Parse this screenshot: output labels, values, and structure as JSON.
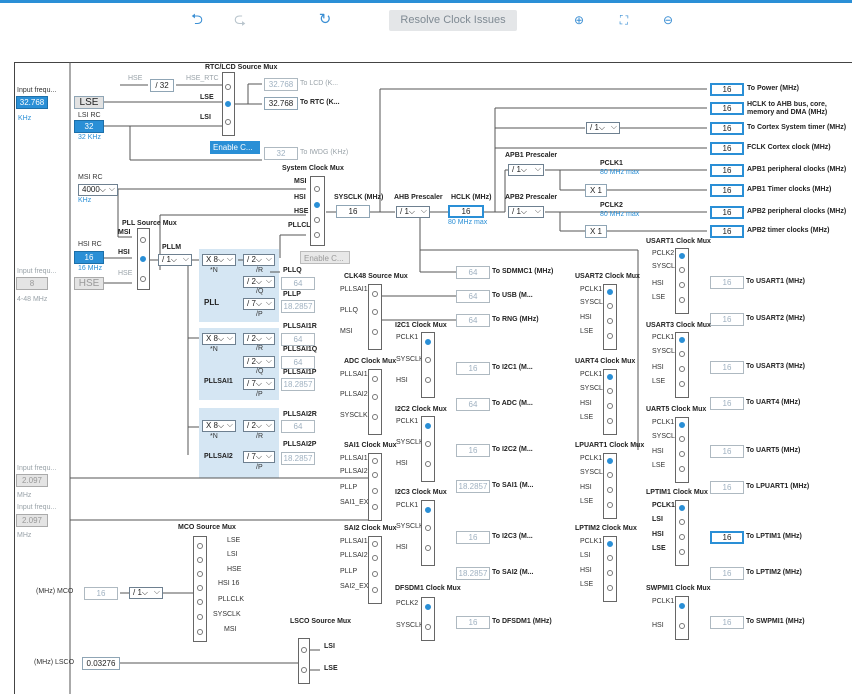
{
  "toolbar": {
    "undo_icon": "undo-icon",
    "redo_icon": "redo-icon",
    "refresh_icon": "refresh-icon",
    "resolve": "Resolve Clock Issues",
    "zoom_in_icon": "zoom-in-icon",
    "fit_icon": "fit-icon",
    "zoom_out_icon": "zoom-out-icon"
  },
  "inputs": {
    "lse_freq_label": "Input frequ...",
    "lse_freq": "32.768",
    "lse_unit": "KHz",
    "lse": "LSE",
    "lsi_rc": "LSI RC",
    "lsi_val": "32",
    "lsi_unit": "32 KHz",
    "msi_rc": "MSI RC",
    "msi_val": "4000",
    "msi_unit": "KHz",
    "hsi_rc": "HSI RC",
    "hsi_val": "16",
    "hsi_unit": "16 MHz",
    "hse_freq_label": "Input frequ...",
    "hse_freq": "8",
    "hse": "HSE",
    "hse_range": "4-48 MHz",
    "in1_label": "Input frequ...",
    "in1": "2.097",
    "in1_unit": "MHz",
    "in2_label": "Input frequ...",
    "in2": "2.097",
    "in2_unit": "MHz"
  },
  "rtc": {
    "title": "RTC/LCD Source Mux",
    "hse": "HSE",
    "div32": "/ 32",
    "hse_rtc": "HSE_RTC",
    "lse": "LSE",
    "lsi": "LSI",
    "lcd_val": "32.768",
    "lcd_label": "To LCD (K...",
    "rtc_val": "32.768",
    "rtc_label": "To RTC (K...",
    "enable": "Enable C...",
    "iwdg_val": "32",
    "iwdg_label": "To IWDG (KHz)"
  },
  "sys": {
    "title": "System Clock Mux",
    "msi": "MSI",
    "hsi": "HSI",
    "hse": "HSE",
    "pllclk": "PLLCLK",
    "enable": "Enable C...",
    "sysclk_label": "SYSCLK (MHz)",
    "sysclk": "16",
    "ahb_label": "AHB Prescaler",
    "ahb": "/ 1",
    "hclk_label": "HCLK (MHz)",
    "hclk": "16",
    "hclk_max": "80 MHz max",
    "apb1_label": "APB1 Prescaler",
    "apb1": "/ 1",
    "apb2_label": "APB2 Prescaler",
    "apb2": "/ 1",
    "pclk1": "PCLK1",
    "pclk1_max": "80 MHz max",
    "pclk2": "PCLK2",
    "pclk2_max": "80 MHz max",
    "cortex_div": "/ 1",
    "x1a": "X 1",
    "x1b": "X 1"
  },
  "outputs": [
    {
      "v": "16",
      "l": "To Power (MHz)"
    },
    {
      "v": "16",
      "l": "HCLK to AHB bus, core, memory and DMA (MHz)"
    },
    {
      "v": "16",
      "l": "To Cortex System timer (MHz)"
    },
    {
      "v": "16",
      "l": "FCLK Cortex clock (MHz)"
    },
    {
      "v": "16",
      "l": "APB1 peripheral clocks (MHz)"
    },
    {
      "v": "16",
      "l": "APB1 Timer clocks (MHz)"
    },
    {
      "v": "16",
      "l": "APB2 peripheral clocks (MHz)"
    },
    {
      "v": "16",
      "l": "APB2 timer clocks (MHz)"
    }
  ],
  "pll": {
    "src_title": "PLL Source Mux",
    "msi": "MSI",
    "hsi": "HSI",
    "hse": "HSE",
    "pllm_label": "PLLM",
    "pllm": "/ 1",
    "pll": "PLL",
    "n": "X 8",
    "n_l": "*N",
    "r": "/ 2",
    "r_l": "/R",
    "q": "/ 2",
    "q_l": "/Q",
    "p": "/ 7",
    "p_l": "/P",
    "pllq": "PLLQ",
    "pllq_v": "64",
    "pllp": "PLLP",
    "pllp_v": "18.2857",
    "sai1": "PLLSAI1",
    "sai1_n": "X 8",
    "sai1_r": "/ 2",
    "sai1_q": "/ 2",
    "sai1_p": "/ 7",
    "sai1r": "PLLSAI1R",
    "sai1r_v": "64",
    "sai1q": "PLLSAI1Q",
    "sai1q_v": "64",
    "sai1p": "PLLSAI1P",
    "sai1p_v": "18.2857",
    "sai2": "PLLSAI2",
    "sai2_n": "X 8",
    "sai2_r": "/ 2",
    "sai2_p": "/ 7",
    "sai2r": "PLLSAI2R",
    "sai2r_v": "64",
    "sai2p": "PLLSAI2P",
    "sai2p_v": "18.2857"
  },
  "mid": {
    "clk48": "CLK48 Source Mux",
    "sdmmc_v": "64",
    "sdmmc": "To SDMMC1 (MHz)",
    "usb_v": "64",
    "usb": "To USB (M...",
    "rng_v": "64",
    "rng": "To RNG (MHz)",
    "i2c1": "I2C1 Clock Mux",
    "i2c1_v": "16",
    "i2c1_l": "To I2C1 (M...",
    "adc": "ADC Clock Mux",
    "adc_v": "64",
    "adc_l": "To ADC (M...",
    "i2c2": "I2C2 Clock Mux",
    "i2c2_v": "16",
    "i2c2_l": "To I2C2 (M...",
    "sai1": "SAI1 Clock Mux",
    "sai1_v": "18.2857",
    "sai1_l": "To SAI1 (M...",
    "i2c3": "I2C3 Clock Mux",
    "i2c3_v": "16",
    "i2c3_l": "To I2C3 (M...",
    "sai2": "SAI2 Clock Mux",
    "sai2_v": "18.2857",
    "sai2_l": "To SAI2 (M...",
    "dfsdm": "DFSDM1 Clock Mux",
    "dfsdm_v": "16",
    "dfsdm_l": "To DFSDM1 (MHz)"
  },
  "right": {
    "usart1": "USART1 Clock Mux",
    "usart1_v": "16",
    "usart1_l": "To USART1 (MHz)",
    "usart2": "USART2 Clock Mux",
    "usart2_v": "16",
    "usart2_l": "To USART2 (MHz)",
    "usart3": "USART3 Clock Mux",
    "usart3_v": "16",
    "usart3_l": "To USART3 (MHz)",
    "uart4": "UART4 Clock Mux",
    "uart4_v": "16",
    "uart4_l": "To UART4 (MHz)",
    "uart5": "UART5 Clock Mux",
    "uart5_v": "16",
    "uart5_l": "To UART5 (MHz)",
    "lpuart1": "LPUART1 Clock Mux",
    "lpuart1_v": "16",
    "lpuart1_l": "To LPUART1 (MHz)",
    "lptim1": "LPTIM1 Clock Mux",
    "lptim1_v": "16",
    "lptim1_l": "To LPTIM1 (MHz)",
    "lptim2": "LPTIM2 Clock Mux",
    "lptim2_v": "16",
    "lptim2_l": "To LPTIM2 (MHz)",
    "swpmi1": "SWPMI1 Clock Mux",
    "swpmi1_v": "16",
    "swpmi1_l": "To SWPMI1 (MHz)"
  },
  "mco": {
    "title": "MCO Source Mux",
    "label": "(MHz) MCO",
    "val": "16",
    "div": "/ 1",
    "lse": "LSE",
    "lsi": "LSI",
    "hse": "HSE",
    "hsi16": "HSI 16",
    "pllclk": "PLLCLK",
    "sysclk": "SYSCLK",
    "msi": "MSI"
  },
  "lsco": {
    "title": "LSCO Source Mux",
    "label": "(MHz) LSCO",
    "val": "0.03276",
    "lsi": "LSI",
    "lse": "LSE"
  },
  "mux_inputs": {
    "pclk1": "PCLK1",
    "pclk2": "PCLK2",
    "sysclk": "SYSCLK",
    "hsi": "HSI",
    "lse": "LSE",
    "lsi": "LSI",
    "pllsai1": "PLLSAI1",
    "pllq": "PLLQ",
    "msi": "MSI",
    "pllsai2": "PLLSAI2",
    "pllp": "PLLP",
    "sai1_ext": "SAI1_EXT",
    "sai2_ext": "SAI2_EXT",
    "pllsai1r": "PLLSAI1R",
    "pllsai1p": "PLLSAI1P",
    "pllsai2p": "PLLSAI2P"
  }
}
